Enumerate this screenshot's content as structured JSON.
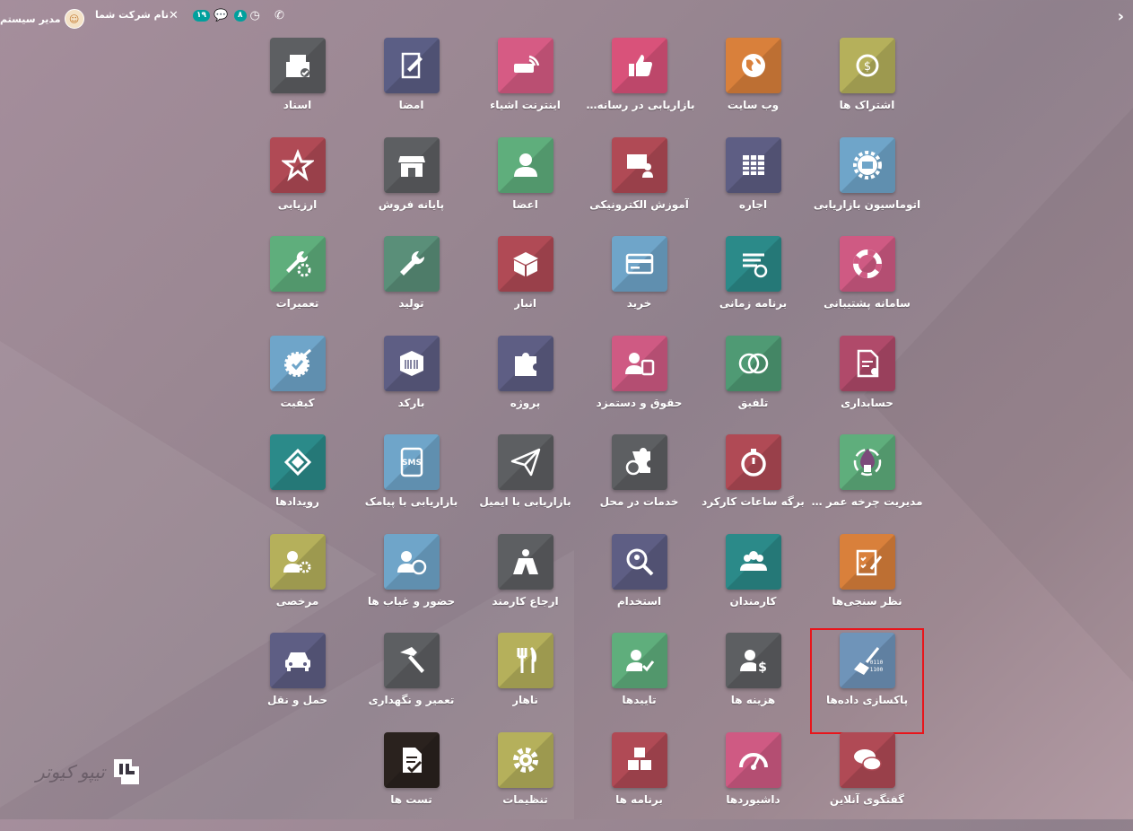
{
  "topbar": {
    "user_name": "مدیر سیستم",
    "company_name": "نام شرکت شما",
    "activity_count": "۸",
    "message_count": "۱۹"
  },
  "apps": [
    {
      "label": "اشتراک ها",
      "color": "#b5b05b",
      "icon": "subscription-icon"
    },
    {
      "label": "وب سایت",
      "color": "#d9803b",
      "icon": "globe-icon"
    },
    {
      "label": "بازاریابی در رسانه ها...",
      "color": "#d9527a",
      "icon": "thumbs-up-icon"
    },
    {
      "label": "اینترنت اشیاء",
      "color": "#d65b84",
      "icon": "iot-icon"
    },
    {
      "label": "امضا",
      "color": "#5b5e85",
      "icon": "sign-icon"
    },
    {
      "label": "اسناد",
      "color": "#5d5f62",
      "icon": "documents-icon"
    },
    {
      "label": "اتوماسیون بازاریابی",
      "color": "#6fa5c9",
      "icon": "gear-mail-icon"
    },
    {
      "label": "اجاره",
      "color": "#5e5e84",
      "icon": "calendar-table-icon"
    },
    {
      "label": "آموزش الکترونیکی",
      "color": "#b04a55",
      "icon": "elearning-icon"
    },
    {
      "label": "اعضا",
      "color": "#5fae7c",
      "icon": "person-icon"
    },
    {
      "label": "پایانه فروش",
      "color": "#5d5f62",
      "icon": "store-icon"
    },
    {
      "label": "ارزیابی",
      "color": "#b04a55",
      "icon": "star-icon"
    },
    {
      "label": "سامانه پشتیبانی",
      "color": "#cf5a83",
      "icon": "lifebuoy-icon"
    },
    {
      "label": "برنامه زمانی",
      "color": "#2b8a89",
      "icon": "planning-icon"
    },
    {
      "label": "خرید",
      "color": "#6fa5c9",
      "icon": "credit-card-icon"
    },
    {
      "label": "انبار",
      "color": "#b04a55",
      "icon": "box-icon"
    },
    {
      "label": "تولید",
      "color": "#5a8f79",
      "icon": "wrench-icon"
    },
    {
      "label": "تعمیرات",
      "color": "#5fae7c",
      "icon": "wrench-gear-icon"
    },
    {
      "label": "حسابداری",
      "color": "#b04a6a",
      "icon": "invoice-icon"
    },
    {
      "label": "تلفیق",
      "color": "#4f9a74",
      "icon": "consolidation-icon"
    },
    {
      "label": "حقوق و دستمزد",
      "color": "#cf5a83",
      "icon": "payroll-icon"
    },
    {
      "label": "پروژه",
      "color": "#5e5e84",
      "icon": "puzzle-icon"
    },
    {
      "label": "بارکد",
      "color": "#5e5e84",
      "icon": "barcode-box-icon"
    },
    {
      "label": "کیفیت",
      "color": "#6fa5c9",
      "icon": "quality-badge-icon"
    },
    {
      "label": "مدیریت چرخه عمر م...",
      "color": "#5fae7c",
      "icon": "plm-icon"
    },
    {
      "label": "برگه ساعات کارکرد",
      "color": "#b04a55",
      "icon": "stopwatch-icon"
    },
    {
      "label": "خدمات در محل",
      "color": "#5d5f62",
      "icon": "field-service-icon"
    },
    {
      "label": "بازاریابی با ایمیل",
      "color": "#5d5f62",
      "icon": "paper-plane-icon"
    },
    {
      "label": "بازاریابی با پیامک",
      "color": "#6fa5c9",
      "icon": "sms-icon"
    },
    {
      "label": "رویدادها",
      "color": "#2b8a89",
      "icon": "ticket-icon"
    },
    {
      "label": "نظر سنجی‌ها",
      "color": "#d9803b",
      "icon": "survey-icon"
    },
    {
      "label": "کارمندان",
      "color": "#2b8a89",
      "icon": "people-icon"
    },
    {
      "label": "استخدام",
      "color": "#5e5e84",
      "icon": "magnifier-person-icon"
    },
    {
      "label": "ارجاع کارمند",
      "color": "#5d5f62",
      "icon": "hero-icon"
    },
    {
      "label": "حضور و غیاب ها",
      "color": "#6fa5c9",
      "icon": "attendance-icon"
    },
    {
      "label": "مرخصی",
      "color": "#b5b05b",
      "icon": "leave-icon"
    },
    {
      "label": "پاکسازی داده‌ها",
      "color": "#6f94b9",
      "icon": "broom-icon",
      "selected": true
    },
    {
      "label": "هزینه ها",
      "color": "#5d5f62",
      "icon": "expense-icon"
    },
    {
      "label": "تاییدها",
      "color": "#5fae7c",
      "icon": "approval-icon"
    },
    {
      "label": "ناهار",
      "color": "#b5b05b",
      "icon": "lunch-icon"
    },
    {
      "label": "تعمیر و نگهداری",
      "color": "#5d5f62",
      "icon": "hammer-icon"
    },
    {
      "label": "حمل و نقل",
      "color": "#5e5e84",
      "icon": "car-icon"
    },
    {
      "label": "گفتگوی آنلاین",
      "color": "#b04a55",
      "icon": "chat-bubbles-icon"
    },
    {
      "label": "داشبوردها",
      "color": "#cf5a83",
      "icon": "gauge-icon"
    },
    {
      "label": "برنامه ها",
      "color": "#b04a55",
      "icon": "cubes-icon"
    },
    {
      "label": "تنظیمات",
      "color": "#b5b05b",
      "icon": "settings-gear-icon"
    },
    {
      "label": "تست ها",
      "color": "#2a221e",
      "icon": "checklist-icon"
    }
  ],
  "watermark": {
    "text": "تیپو کیوتر"
  }
}
